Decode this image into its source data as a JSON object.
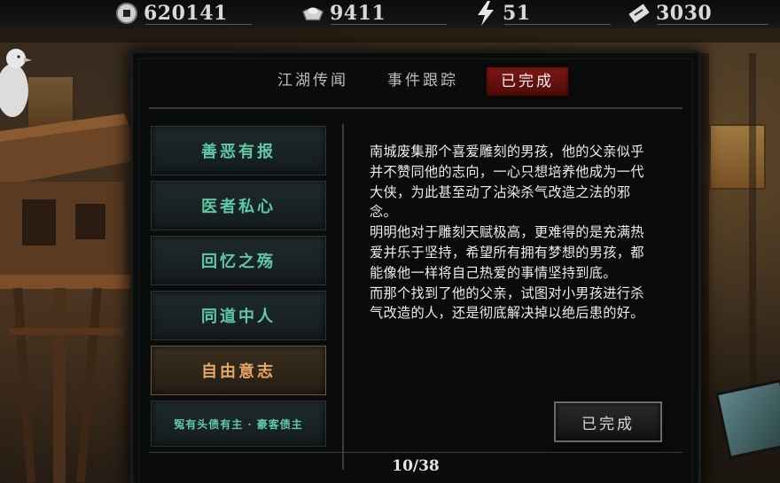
{
  "resources": [
    {
      "icon": "coin-icon",
      "value": "620141"
    },
    {
      "icon": "silver-ingot-icon",
      "value": "9411"
    },
    {
      "icon": "lightning-icon",
      "value": "51"
    },
    {
      "icon": "ticket-icon",
      "value": "3030"
    }
  ],
  "tabs": [
    {
      "label": "江湖传闻",
      "active": false
    },
    {
      "label": "事件跟踪",
      "active": false
    },
    {
      "label": "已完成",
      "active": true
    }
  ],
  "quests": [
    {
      "label": "善恶有报",
      "selected": false
    },
    {
      "label": "医者私心",
      "selected": false
    },
    {
      "label": "回忆之殇",
      "selected": false
    },
    {
      "label": "同道中人",
      "selected": false
    },
    {
      "label": "自由意志",
      "selected": true
    },
    {
      "label": "冤有头债有主 · 豪客债主",
      "selected": false
    }
  ],
  "description": {
    "paragraphs": [
      "南城废集那个喜爱雕刻的男孩，他的父亲似乎并不赞同他的志向，一心只想培养他成为一代大侠，为此甚至动了沾染杀气改造之法的邪念。",
      "明明他对于雕刻天赋极高，更难得的是充满热爱并乐于坚持，希望所有拥有梦想的男孩，都能像他一样将自己热爱的事情坚持到底。",
      "而那个找到了他的父亲，试图对小男孩进行杀气改造的人，还是彻底解决掉以绝后患的好。"
    ]
  },
  "status_button": {
    "label": "已完成"
  },
  "pager": {
    "text": "10/38"
  },
  "colors": {
    "quest_text": "#5fc9a6",
    "selected_quest_text": "#e2a769",
    "active_tab": "#7e1714"
  }
}
